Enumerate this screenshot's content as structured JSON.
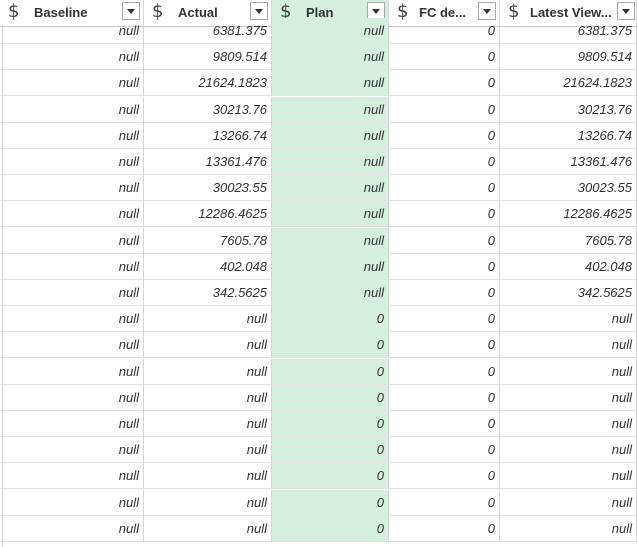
{
  "columns": [
    {
      "title": "Baseline",
      "icon": "dollar-sign-icon"
    },
    {
      "title": "Actual",
      "icon": "dollar-sign-icon"
    },
    {
      "title": "Plan",
      "icon": "dollar-sign-icon",
      "selected": true
    },
    {
      "title": "FC de...",
      "icon": "dollar-sign-icon"
    },
    {
      "title": "Latest View...",
      "icon": "dollar-sign-icon"
    }
  ],
  "currency_symbol": "$",
  "selected_color": "#d5efdf",
  "rows": [
    [
      "null",
      "6381.375",
      "null",
      "0",
      "6381.375"
    ],
    [
      "null",
      "9809.514",
      "null",
      "0",
      "9809.514"
    ],
    [
      "null",
      "21624.1823",
      "null",
      "0",
      "21624.1823"
    ],
    [
      "null",
      "30213.76",
      "null",
      "0",
      "30213.76"
    ],
    [
      "null",
      "13266.74",
      "null",
      "0",
      "13266.74"
    ],
    [
      "null",
      "13361.476",
      "null",
      "0",
      "13361.476"
    ],
    [
      "null",
      "30023.55",
      "null",
      "0",
      "30023.55"
    ],
    [
      "null",
      "12286.4625",
      "null",
      "0",
      "12286.4625"
    ],
    [
      "null",
      "7605.78",
      "null",
      "0",
      "7605.78"
    ],
    [
      "null",
      "402.048",
      "null",
      "0",
      "402.048"
    ],
    [
      "null",
      "342.5625",
      "null",
      "0",
      "342.5625"
    ],
    [
      "null",
      "null",
      "0",
      "0",
      "null"
    ],
    [
      "null",
      "null",
      "0",
      "0",
      "null"
    ],
    [
      "null",
      "null",
      "0",
      "0",
      "null"
    ],
    [
      "null",
      "null",
      "0",
      "0",
      "null"
    ],
    [
      "null",
      "null",
      "0",
      "0",
      "null"
    ],
    [
      "null",
      "null",
      "0",
      "0",
      "null"
    ],
    [
      "null",
      "null",
      "0",
      "0",
      "null"
    ],
    [
      "null",
      "null",
      "0",
      "0",
      "null"
    ],
    [
      "null",
      "null",
      "0",
      "0",
      "null"
    ]
  ]
}
